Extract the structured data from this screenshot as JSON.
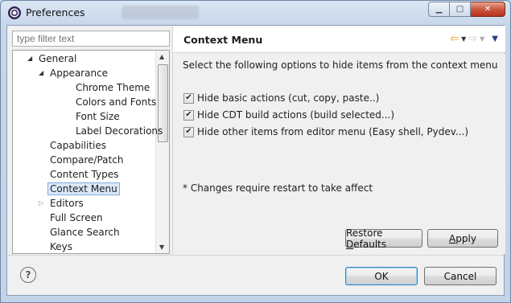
{
  "window": {
    "title": "Preferences",
    "minimize_glyph": "▁",
    "maximize_glyph": "□",
    "close_glyph": "✕"
  },
  "filter": {
    "placeholder": "type filter text"
  },
  "tree": {
    "items": [
      {
        "label": "General",
        "level": 0,
        "twisty": "expanded"
      },
      {
        "label": "Appearance",
        "level": 1,
        "twisty": "expanded"
      },
      {
        "label": "Chrome Theme",
        "level": 2,
        "twisty": "none"
      },
      {
        "label": "Colors and Fonts",
        "level": 2,
        "twisty": "none"
      },
      {
        "label": "Font Size",
        "level": 2,
        "twisty": "none"
      },
      {
        "label": "Label Decorations",
        "level": 2,
        "twisty": "none"
      },
      {
        "label": "Capabilities",
        "level": 1,
        "twisty": "none"
      },
      {
        "label": "Compare/Patch",
        "level": 1,
        "twisty": "none"
      },
      {
        "label": "Content Types",
        "level": 1,
        "twisty": "none"
      },
      {
        "label": "Context Menu",
        "level": 1,
        "twisty": "none",
        "selected": true
      },
      {
        "label": "Editors",
        "level": 1,
        "twisty": "collapsed"
      },
      {
        "label": "Full Screen",
        "level": 1,
        "twisty": "none"
      },
      {
        "label": "Glance Search",
        "level": 1,
        "twisty": "none"
      },
      {
        "label": "Keys",
        "level": 1,
        "twisty": "none"
      }
    ]
  },
  "page": {
    "title": "Context Menu",
    "description": "Select the following options to hide items from the context menu",
    "options": [
      {
        "label": "Hide basic actions (cut, copy, paste..)",
        "checked": true
      },
      {
        "label": "Hide CDT build actions (build selected...)",
        "checked": true
      },
      {
        "label": "Hide other items from editor menu (Easy shell, Pydev...)",
        "checked": true
      }
    ],
    "note": "* Changes require restart to take affect",
    "restore_defaults": {
      "before": "Restore ",
      "mnemonic": "D",
      "after": "efaults"
    },
    "apply": {
      "mnemonic": "A",
      "after": "pply"
    }
  },
  "nav": {
    "back_glyph": "⇦",
    "forward_glyph": "⇨",
    "dropdown_glyph": "▼",
    "menu_glyph": "▼"
  },
  "footer": {
    "ok_label": "OK",
    "cancel_label": "Cancel",
    "help_glyph": "?"
  },
  "colors": {
    "selection_bg": "#d9e8fb",
    "selection_border": "#84acdd",
    "default_button_border": "#3c7fb1"
  }
}
